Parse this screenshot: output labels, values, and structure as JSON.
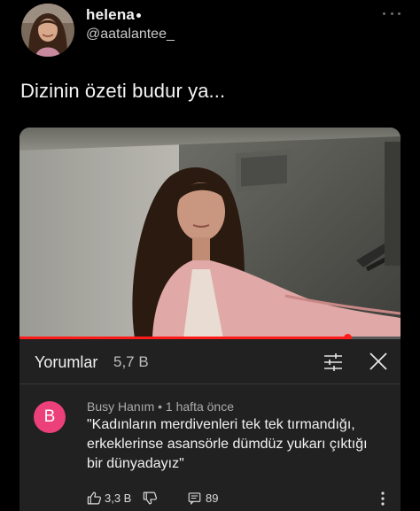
{
  "author": {
    "display_name": "helena",
    "handle": "@aatalantee_"
  },
  "tweet": {
    "text": "Dizinin özeti budur ya..."
  },
  "video": {
    "progress": 0.86
  },
  "comments_panel": {
    "title": "Yorumlar",
    "count": "5,7 B"
  },
  "comment": {
    "avatar_letter": "B",
    "meta": "Busy Hanım • 1 hafta önce",
    "lines": [
      "\"Kadınların merdivenleri tek tek tırmandığı,",
      "erkeklerinse asansörle dümdüz yukarı çıktığı",
      "bir dünyadayız\""
    ],
    "like_count": "3,3 B",
    "reply_count": "89"
  },
  "colors": {
    "background": "#000000",
    "panel": "#212121",
    "progress": "#ff1a1a",
    "comment_avatar": "#ec407a"
  },
  "icons": {
    "more": "more-horizontal-icon",
    "filter": "filter-sliders-icon",
    "close": "close-icon",
    "like": "thumbs-up-icon",
    "dislike": "thumbs-down-icon",
    "reply": "comment-icon",
    "comment_menu": "more-vertical-icon"
  }
}
